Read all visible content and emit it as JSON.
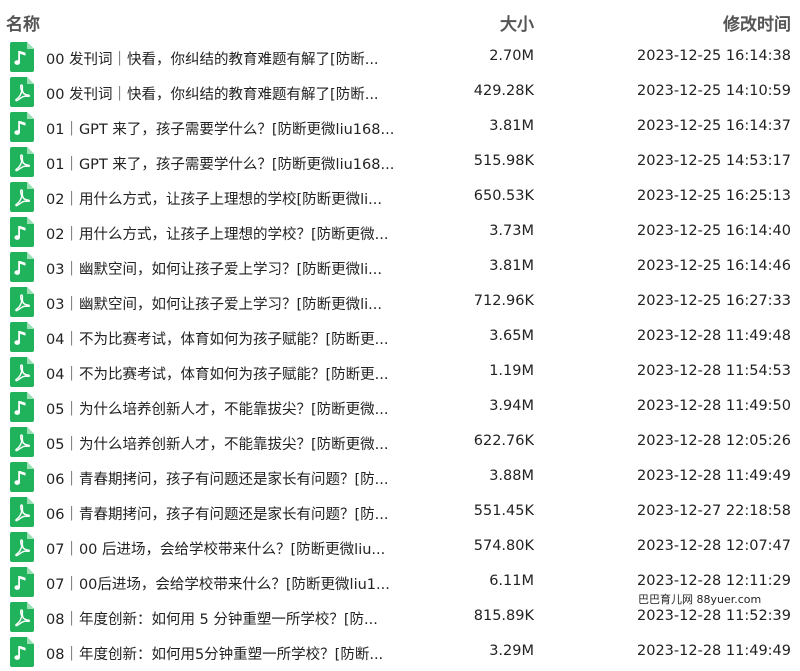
{
  "colors": {
    "audio_icon": "#21b35b",
    "pdf_icon": "#21b35b",
    "header_text": "#555555"
  },
  "header": {
    "name": "名称",
    "size": "大小",
    "time": "修改时间"
  },
  "files": [
    {
      "icon": "music-note-icon",
      "name": "00 发刊词｜快看，你纠结的教育难题有解了[防断...",
      "size": "2.70M",
      "time": "2023-12-25 16:14:38"
    },
    {
      "icon": "pdf-icon",
      "name": "00 发刊词｜快看，你纠结的教育难题有解了[防断...",
      "size": "429.28K",
      "time": "2023-12-25 14:10:59"
    },
    {
      "icon": "music-note-icon",
      "name": "01｜GPT 来了，孩子需要学什么？[防断更微liu168...",
      "size": "3.81M",
      "time": "2023-12-25 16:14:37"
    },
    {
      "icon": "pdf-icon",
      "name": "01｜GPT 来了，孩子需要学什么？[防断更微liu168...",
      "size": "515.98K",
      "time": "2023-12-25 14:53:17"
    },
    {
      "icon": "pdf-icon",
      "name": "02｜用什么方式，让孩子上理想的学校[防断更微li...",
      "size": "650.53K",
      "time": "2023-12-25 16:25:13"
    },
    {
      "icon": "music-note-icon",
      "name": "02｜用什么方式，让孩子上理想的学校？[防断更微...",
      "size": "3.73M",
      "time": "2023-12-25 16:14:40"
    },
    {
      "icon": "music-note-icon",
      "name": "03｜幽默空间，如何让孩子爱上学习？[防断更微li...",
      "size": "3.81M",
      "time": "2023-12-25 16:14:46"
    },
    {
      "icon": "pdf-icon",
      "name": "03｜幽默空间，如何让孩子爱上学习？[防断更微li...",
      "size": "712.96K",
      "time": "2023-12-25 16:27:33"
    },
    {
      "icon": "music-note-icon",
      "name": "04｜不为比赛考试，体育如何为孩子赋能？[防断更...",
      "size": "3.65M",
      "time": "2023-12-28 11:49:48"
    },
    {
      "icon": "pdf-icon",
      "name": "04｜不为比赛考试，体育如何为孩子赋能？[防断更...",
      "size": "1.19M",
      "time": "2023-12-28 11:54:53"
    },
    {
      "icon": "music-note-icon",
      "name": "05｜为什么培养创新人才，不能靠拔尖？[防断更微...",
      "size": "3.94M",
      "time": "2023-12-28 11:49:50"
    },
    {
      "icon": "pdf-icon",
      "name": "05｜为什么培养创新人才，不能靠拔尖？[防断更微...",
      "size": "622.76K",
      "time": "2023-12-28 12:05:26"
    },
    {
      "icon": "music-note-icon",
      "name": "06｜青春期拷问，孩子有问题还是家长有问题？[防...",
      "size": "3.88M",
      "time": "2023-12-28 11:49:49"
    },
    {
      "icon": "pdf-icon",
      "name": "06｜青春期拷问，孩子有问题还是家长有问题？[防...",
      "size": "551.45K",
      "time": "2023-12-27 22:18:58"
    },
    {
      "icon": "pdf-icon",
      "name": "07｜00 后进场，会给学校带来什么？[防断更微liu...",
      "size": "574.80K",
      "time": "2023-12-28 12:07:47"
    },
    {
      "icon": "music-note-icon",
      "name": "07｜00后进场，会给学校带来什么？[防断更微liu1...",
      "size": "6.11M",
      "time": "2023-12-28 12:11:29"
    },
    {
      "icon": "pdf-icon",
      "name": "08｜年度创新：如何用 5 分钟重塑一所学校？[防...",
      "size": "815.89K",
      "time": "2023-12-28 11:52:39"
    },
    {
      "icon": "music-note-icon",
      "name": "08｜年度创新：如何用5分钟重塑一所学校？[防断...",
      "size": "3.29M",
      "time": "2023-12-28 11:49:49"
    }
  ],
  "watermark": "巴巴育儿网 88yuer.com"
}
